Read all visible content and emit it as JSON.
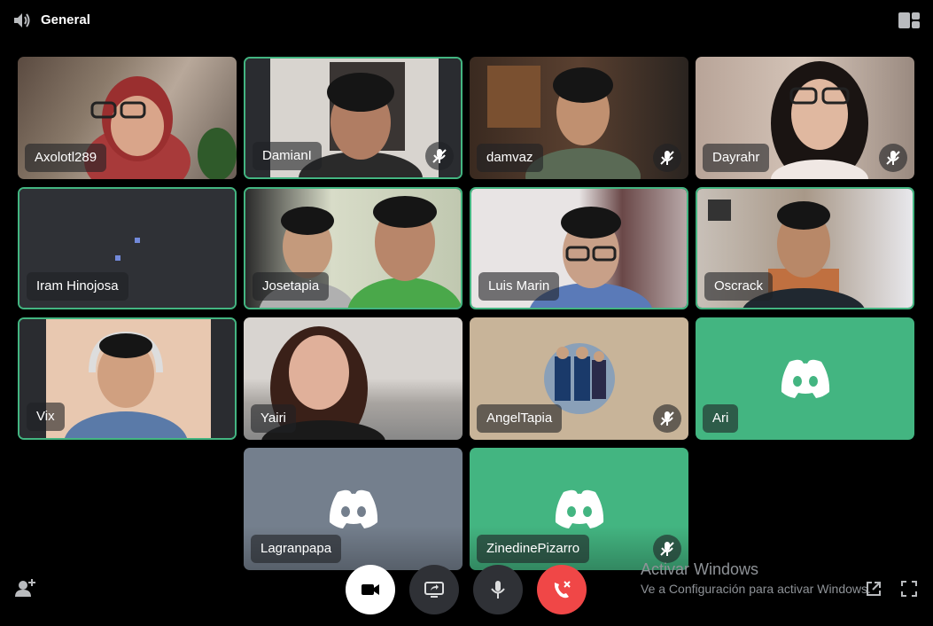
{
  "channel": {
    "name": "General",
    "icon": "speaker-icon"
  },
  "colors": {
    "speaking_border": "#43b581",
    "discord_green": "#43b581",
    "discord_gray": "#747f8d",
    "hangup_red": "#f04747",
    "background": "#000000"
  },
  "participants": [
    {
      "name": "Axolotl289",
      "muted": false,
      "speaking": false,
      "video": true
    },
    {
      "name": "DamianI",
      "muted": true,
      "speaking": true,
      "video": true
    },
    {
      "name": "damvaz",
      "muted": true,
      "speaking": false,
      "video": true
    },
    {
      "name": "Dayrahr",
      "muted": true,
      "speaking": false,
      "video": true
    },
    {
      "name": "Iram Hinojosa",
      "muted": false,
      "speaking": true,
      "video": true
    },
    {
      "name": "Josetapia",
      "muted": false,
      "speaking": true,
      "video": true
    },
    {
      "name": "Luis Marin",
      "muted": false,
      "speaking": true,
      "video": true
    },
    {
      "name": "Oscrack",
      "muted": false,
      "speaking": true,
      "video": true
    },
    {
      "name": "Vix",
      "muted": false,
      "speaking": true,
      "video": true
    },
    {
      "name": "Yairi",
      "muted": false,
      "speaking": false,
      "video": true
    },
    {
      "name": "AngelTapia",
      "muted": true,
      "speaking": false,
      "video": false
    },
    {
      "name": "Ari",
      "muted": false,
      "speaking": false,
      "video": false
    },
    {
      "name": "Lagranpapa",
      "muted": false,
      "speaking": false,
      "video": false
    },
    {
      "name": "ZinedinePizarro",
      "muted": true,
      "speaking": false,
      "video": false
    }
  ],
  "controls": [
    "camera-icon",
    "screen-share-icon",
    "microphone-icon",
    "hang-up-icon"
  ],
  "watermark": {
    "title": "Activar Windows",
    "subtitle": "Ve a Configuración para activar Windows."
  }
}
